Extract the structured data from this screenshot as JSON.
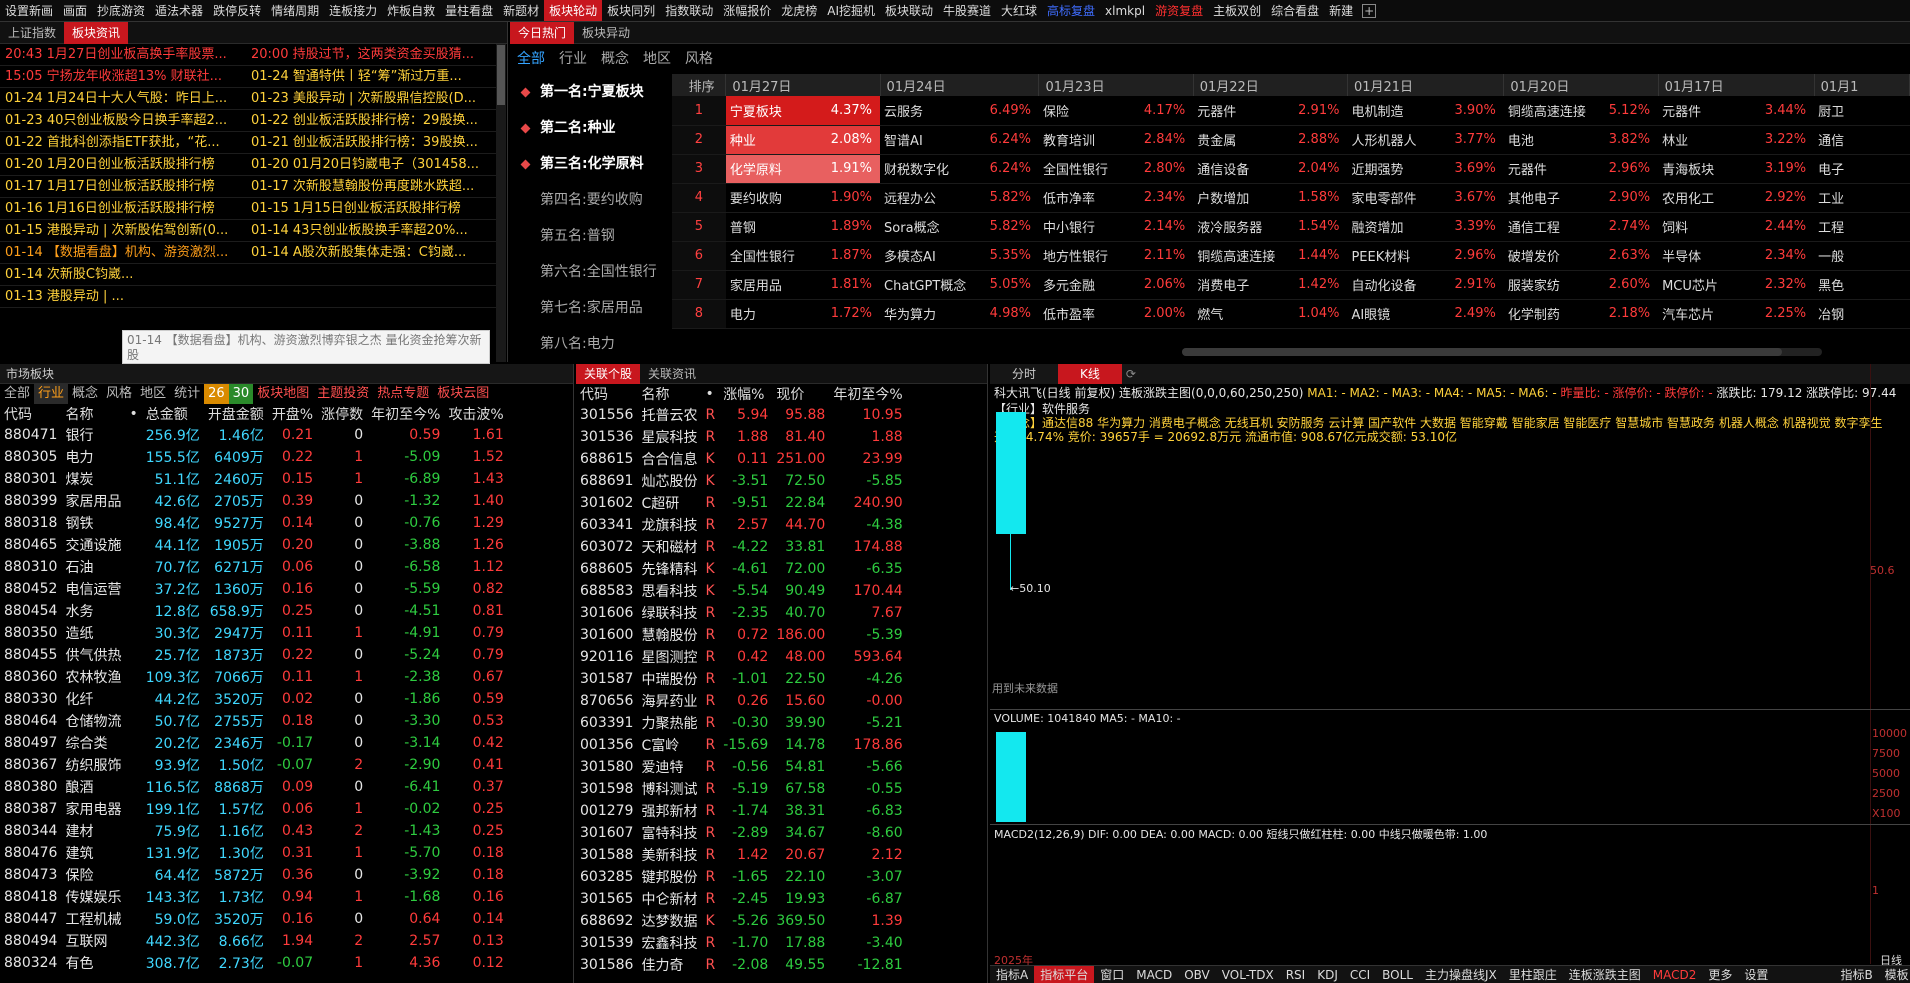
{
  "topnav": [
    "设置新画",
    "画面",
    "抄底游资",
    "遁法术器",
    "跌停反转",
    "情绪周期",
    "连板接力",
    "炸板自救",
    "量柱看盘",
    "新题材",
    "板块轮动",
    "板块同列",
    "指数联动",
    "涨幅报价",
    "龙虎榜",
    "AI挖掘机",
    "板块联动",
    "牛股赛道",
    "大红球",
    "高标复盘",
    "xlmkpl",
    "游资复盘",
    "主板双创",
    "综合看盘",
    "新建"
  ],
  "news": {
    "tabs": [
      "上证指数",
      "板块资讯"
    ],
    "left": [
      {
        "t": "20:43 1月27日创业板高换手率股票...",
        "c": "red"
      },
      {
        "t": "15:05 宁扬龙年收涨超13% 财联社...",
        "c": "red"
      },
      {
        "t": "01-24 1月24日十大人气股：昨日上...",
        "c": "yellow"
      },
      {
        "t": "01-23 40只创业板股今日换手率超2...",
        "c": "yellow"
      },
      {
        "t": "01-22 首批科创添指ETF获批，“花...",
        "c": "yellow"
      },
      {
        "t": "01-20 1月20日创业板活跃股排行榜",
        "c": "yellow"
      },
      {
        "t": "01-17 1月17日创业板活跃股排行榜",
        "c": "yellow"
      },
      {
        "t": "01-16 1月16日创业板活跃股排行榜",
        "c": "yellow"
      },
      {
        "t": "01-15 港股异动 | 次新股佑驾创新(0...",
        "c": "yellow"
      },
      {
        "t": "01-14 【数据看盘】机构、游资激烈...",
        "c": "orange"
      },
      {
        "t": "01-14 次新股C钧崴...",
        "c": "yellow"
      },
      {
        "t": "01-13 港股异动 | ...",
        "c": "yellow"
      }
    ],
    "right": [
      {
        "t": "20:00 持股过节，这两类资金买股猜...",
        "c": "red"
      },
      {
        "t": "01-24 智通特供丨轻“筹”渐过万重...",
        "c": "yellow"
      },
      {
        "t": "01-23 美股异动 | 次新股鼎信控股(D...",
        "c": "yellow"
      },
      {
        "t": "01-22 创业板活跃股排行榜：29股换...",
        "c": "yellow"
      },
      {
        "t": "01-21 创业板活跃股排行榜：39股换...",
        "c": "yellow"
      },
      {
        "t": "01-20 01月20日钧崴电子（301458...",
        "c": "yellow"
      },
      {
        "t": "01-17 次新股慧翰股份再度跳水跌超...",
        "c": "yellow"
      },
      {
        "t": "01-15 1月15日创业板活跃股排行榜",
        "c": "yellow"
      },
      {
        "t": "01-14 43只创业板股换手率超20%...",
        "c": "yellow"
      },
      {
        "t": "01-14 A股次新股集体走强：C钧崴...",
        "c": "yellow"
      },
      {
        "t": "",
        "c": "yellow"
      },
      {
        "t": "",
        "c": "yellow"
      }
    ],
    "tooltip": "01-14 【数据看盘】机构、游资激烈博弈银之杰 量化资金抢筹次新股"
  },
  "hot": {
    "tabs": [
      "今日热门",
      "板块异动"
    ],
    "subtabs": [
      "全部",
      "行业",
      "概念",
      "地区",
      "风格"
    ],
    "ranks": [
      "第一名:宁夏板块",
      "第二名:种业",
      "第三名:化学原料",
      "第四名:要约收购",
      "第五名:普钢",
      "第六名:全国性银行",
      "第七名:家居用品",
      "第八名:电力"
    ],
    "header": [
      "排序",
      "01月27日",
      "01月24日",
      "01月23日",
      "01月22日",
      "01月21日",
      "01月20日",
      "01月17日",
      "01月1"
    ],
    "rows": [
      [
        "1",
        "宁夏板块",
        "4.37%",
        "云服务",
        "6.49%",
        "保险",
        "4.17%",
        "元器件",
        "2.91%",
        "电机制造",
        "3.90%",
        "铜缆高速连接",
        "5.12%",
        "元器件",
        "3.44%",
        "厨卫"
      ],
      [
        "2",
        "种业",
        "2.08%",
        "智谱AI",
        "6.24%",
        "教育培训",
        "2.84%",
        "贵金属",
        "2.88%",
        "人形机器人",
        "3.77%",
        "电池",
        "3.82%",
        "林业",
        "3.22%",
        "通信"
      ],
      [
        "3",
        "化学原料",
        "1.91%",
        "财税数字化",
        "6.24%",
        "全国性银行",
        "2.80%",
        "通信设备",
        "2.04%",
        "近期强势",
        "3.69%",
        "元器件",
        "2.96%",
        "青海板块",
        "3.19%",
        "电子"
      ],
      [
        "4",
        "要约收购",
        "1.90%",
        "远程办公",
        "5.82%",
        "低市净率",
        "2.34%",
        "户数增加",
        "1.58%",
        "家电零部件",
        "3.67%",
        "其他电子",
        "2.90%",
        "农用化工",
        "2.92%",
        "工业"
      ],
      [
        "5",
        "普钢",
        "1.89%",
        "Sora概念",
        "5.82%",
        "中小银行",
        "2.14%",
        "液冷服务器",
        "1.54%",
        "融资增加",
        "3.39%",
        "通信工程",
        "2.74%",
        "饲料",
        "2.44%",
        "工程"
      ],
      [
        "6",
        "全国性银行",
        "1.87%",
        "多模态AI",
        "5.35%",
        "地方性银行",
        "2.11%",
        "铜缆高速连接",
        "1.44%",
        "PEEK材料",
        "2.96%",
        "破增发价",
        "2.63%",
        "半导体",
        "2.34%",
        "一般"
      ],
      [
        "7",
        "家居用品",
        "1.81%",
        "ChatGPT概念",
        "5.05%",
        "多元金融",
        "2.06%",
        "消费电子",
        "1.42%",
        "自动化设备",
        "2.91%",
        "服装家纺",
        "2.60%",
        "MCU芯片",
        "2.32%",
        "黑色"
      ],
      [
        "8",
        "电力",
        "1.72%",
        "华为算力",
        "4.98%",
        "低市盈率",
        "2.00%",
        "燃气",
        "1.04%",
        "AI眼镜",
        "2.49%",
        "化学制药",
        "2.18%",
        "汽车芯片",
        "2.25%",
        "冶钢"
      ]
    ]
  },
  "market": {
    "title": "市场板块",
    "subnav": [
      "全部",
      "行业",
      "概念",
      "风格",
      "地区",
      "统计",
      "26",
      "30",
      "板块地图",
      "主题投资",
      "热点专题",
      "板块云图"
    ],
    "header": [
      "代码",
      "名称",
      "•",
      "总金额",
      "开盘金额",
      "开盘%",
      "涨停数",
      "年初至今%",
      "攻击波%"
    ],
    "rows": [
      [
        "880471",
        "银行",
        "256.9亿",
        "1.46亿",
        "0.21",
        "0",
        "0.59",
        "1.61"
      ],
      [
        "880305",
        "电力",
        "155.5亿",
        "6409万",
        "0.22",
        "1",
        "-5.09",
        "1.52"
      ],
      [
        "880301",
        "煤炭",
        "51.1亿",
        "2460万",
        "0.15",
        "1",
        "-6.89",
        "1.43"
      ],
      [
        "880399",
        "家居用品",
        "42.6亿",
        "2705万",
        "0.39",
        "0",
        "-1.32",
        "1.40"
      ],
      [
        "880318",
        "钢铁",
        "98.4亿",
        "9527万",
        "0.14",
        "0",
        "-0.76",
        "1.29"
      ],
      [
        "880465",
        "交通设施",
        "44.1亿",
        "1905万",
        "0.20",
        "0",
        "-3.88",
        "1.26"
      ],
      [
        "880310",
        "石油",
        "70.7亿",
        "6271万",
        "0.06",
        "0",
        "-6.58",
        "1.12"
      ],
      [
        "880452",
        "电信运营",
        "37.2亿",
        "1360万",
        "0.16",
        "0",
        "-5.59",
        "0.82"
      ],
      [
        "880454",
        "水务",
        "12.8亿",
        "658.9万",
        "0.25",
        "0",
        "-4.51",
        "0.81"
      ],
      [
        "880350",
        "造纸",
        "30.3亿",
        "2947万",
        "0.11",
        "1",
        "-4.91",
        "0.79"
      ],
      [
        "880455",
        "供气供热",
        "25.7亿",
        "1873万",
        "0.22",
        "0",
        "-5.24",
        "0.79"
      ],
      [
        "880360",
        "农林牧渔",
        "109.3亿",
        "7066万",
        "0.11",
        "1",
        "-2.38",
        "0.67"
      ],
      [
        "880330",
        "化纤",
        "44.2亿",
        "3520万",
        "0.02",
        "0",
        "-1.86",
        "0.59"
      ],
      [
        "880464",
        "仓储物流",
        "50.7亿",
        "2755万",
        "0.18",
        "0",
        "-3.30",
        "0.53"
      ],
      [
        "880497",
        "综合类",
        "20.2亿",
        "2346万",
        "-0.17",
        "0",
        "-3.14",
        "0.42"
      ],
      [
        "880367",
        "纺织服饰",
        "93.9亿",
        "1.50亿",
        "-0.07",
        "2",
        "-2.90",
        "0.41"
      ],
      [
        "880380",
        "酿酒",
        "116.5亿",
        "8868万",
        "0.09",
        "0",
        "-6.41",
        "0.37"
      ],
      [
        "880387",
        "家用电器",
        "199.1亿",
        "1.57亿",
        "0.06",
        "1",
        "-0.02",
        "0.25"
      ],
      [
        "880344",
        "建材",
        "75.9亿",
        "1.16亿",
        "0.43",
        "2",
        "-1.43",
        "0.25"
      ],
      [
        "880476",
        "建筑",
        "131.9亿",
        "1.30亿",
        "0.31",
        "1",
        "-5.70",
        "0.18"
      ],
      [
        "880473",
        "保险",
        "64.4亿",
        "5872万",
        "0.36",
        "0",
        "-3.92",
        "0.18"
      ],
      [
        "880418",
        "传媒娱乐",
        "143.3亿",
        "1.73亿",
        "0.94",
        "1",
        "-1.68",
        "0.16"
      ],
      [
        "880447",
        "工程机械",
        "59.0亿",
        "3520万",
        "0.16",
        "0",
        "0.64",
        "0.14"
      ],
      [
        "880494",
        "互联网",
        "442.3亿",
        "8.66亿",
        "1.94",
        "2",
        "2.57",
        "0.13"
      ],
      [
        "880324",
        "有色",
        "308.7亿",
        "2.73亿",
        "-0.07",
        "1",
        "4.36",
        "0.12"
      ]
    ]
  },
  "related": {
    "tabs": [
      "关联个股",
      "关联资讯"
    ],
    "header": [
      "代码",
      "名称",
      "•",
      "涨幅%",
      "现价",
      "年初至今%"
    ],
    "rows": [
      [
        "301556",
        "托普云农",
        "R",
        "5.94",
        "95.88",
        "10.95"
      ],
      [
        "301536",
        "星宸科技",
        "R",
        "1.88",
        "81.40",
        "1.88"
      ],
      [
        "688615",
        "合合信息",
        "K",
        "0.11",
        "251.00",
        "23.99"
      ],
      [
        "688691",
        "灿芯股份",
        "K",
        "-3.51",
        "72.50",
        "-5.85"
      ],
      [
        "301602",
        "C超研",
        "R",
        "-9.51",
        "22.84",
        "240.90"
      ],
      [
        "603341",
        "龙旗科技",
        "R",
        "2.57",
        "44.70",
        "-4.38"
      ],
      [
        "603072",
        "天和磁材",
        "R",
        "-4.22",
        "33.81",
        "174.88"
      ],
      [
        "688605",
        "先锋精科",
        "K",
        "-4.61",
        "72.00",
        "-6.35"
      ],
      [
        "688583",
        "思看科技",
        "K",
        "-5.54",
        "90.49",
        "170.44"
      ],
      [
        "301606",
        "绿联科技",
        "R",
        "-2.35",
        "40.70",
        "7.67"
      ],
      [
        "301600",
        "慧翰股份",
        "R",
        "0.72",
        "186.00",
        "-5.39"
      ],
      [
        "920116",
        "星图测控",
        "R",
        "0.42",
        "48.00",
        "593.64"
      ],
      [
        "301587",
        "中瑞股份",
        "R",
        "-1.01",
        "22.50",
        "-4.26"
      ],
      [
        "870656",
        "海昇药业",
        "R",
        "0.26",
        "15.60",
        "-0.00"
      ],
      [
        "603391",
        "力聚热能",
        "R",
        "-0.30",
        "39.90",
        "-5.21"
      ],
      [
        "001356",
        "C富岭",
        "R",
        "-15.69",
        "14.78",
        "178.86"
      ],
      [
        "301580",
        "爱迪特",
        "R",
        "-0.56",
        "54.81",
        "-5.66"
      ],
      [
        "301598",
        "博科测试",
        "R",
        "-5.19",
        "67.58",
        "-0.55"
      ],
      [
        "001279",
        "强邦新材",
        "R",
        "-1.74",
        "38.31",
        "-6.83"
      ],
      [
        "301607",
        "富特科技",
        "R",
        "-2.89",
        "34.67",
        "-8.60"
      ],
      [
        "301588",
        "美新科技",
        "R",
        "1.42",
        "20.67",
        "2.12"
      ],
      [
        "603285",
        "键邦股份",
        "R",
        "-1.65",
        "22.10",
        "-3.07"
      ],
      [
        "301565",
        "中仑新材",
        "R",
        "-2.45",
        "19.93",
        "-6.87"
      ],
      [
        "688692",
        "达梦数据",
        "K",
        "-5.26",
        "369.50",
        "1.39"
      ],
      [
        "301539",
        "宏鑫科技",
        "R",
        "-1.70",
        "17.88",
        "-3.40"
      ],
      [
        "301586",
        "佳力奇",
        "R",
        "-2.08",
        "49.55",
        "-12.81"
      ]
    ]
  },
  "chart": {
    "tabs": [
      "分时",
      "K线"
    ],
    "stock": "科大讯飞(日线 前复权)",
    "indicator": "连板涨跌主图(0,0,0,60,250,250)",
    "ma": "MA1: -  MA2: -  MA3: -  MA4: -  MA5: -  MA6: -",
    "extras": "昨量比: -  涨停价: -  跌停价: -",
    "lbzd": "涨跌比: 179.12  涨跌停比: 97.44",
    "industry_tag": "【行业】软件服务",
    "concept_tag": "【概念】通达信88 华为算力 消费电子概念 无线耳机 安防服务 云计算 国产软件 大数据 智能穿戴 智能家居 智能医疗 智慧城市 智慧政务 机器人概念 机器视觉 数字孪生",
    "open_info": "开盘: 4.74%    竞价: 39657手 = 20692.8万元 流通市值: 908.67亿元成交额: 53.10亿",
    "low_label": "50.10",
    "price_axis": "50.6",
    "future_label": "用到未来数据",
    "volume": "VOLUME: 1041840  MA5: -  MA10: -",
    "vol_axis": [
      "10000",
      "7500",
      "5000",
      "2500",
      "X100"
    ],
    "macd": "MACD2(12,26,9)  DIF: 0.00  DEA: 0.00  MACD: 0.00  短线只做红柱柱: 0.00  中线只做暖色带: 1.00",
    "macd_axis": "1",
    "year": "2025年",
    "daylabel": "日线",
    "bottomtabs": [
      "指标A",
      "指标平台",
      "窗口",
      "MACD",
      "OBV",
      "VOL-TDX",
      "RSI",
      "KDJ",
      "CCI",
      "BOLL",
      "主力操盘线JX",
      "里柱跟庄",
      "连板涨跌主图",
      "MACD2",
      "更多",
      "设置",
      "指标B",
      "模板"
    ]
  }
}
